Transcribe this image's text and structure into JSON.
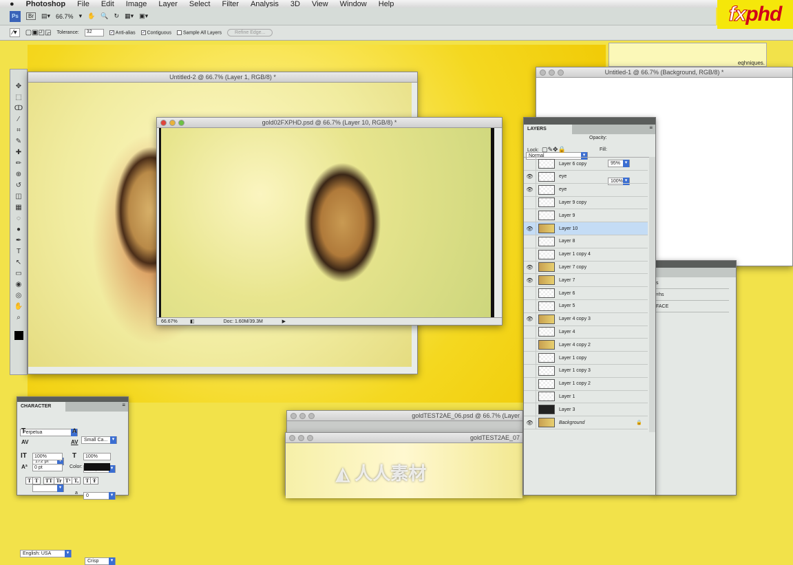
{
  "menubar": {
    "app": "Photoshop",
    "items": [
      "File",
      "Edit",
      "Image",
      "Layer",
      "Select",
      "Filter",
      "Analysis",
      "3D",
      "View",
      "Window",
      "Help"
    ]
  },
  "appbar": {
    "ps": "Ps",
    "br": "Br",
    "zoom": "66.7%"
  },
  "options": {
    "tolerance_label": "Tolerance:",
    "tolerance": "32",
    "anti_alias": "Anti-alias",
    "contiguous": "Contiguous",
    "sample_all": "Sample All Layers",
    "refine": "Refine Edge..."
  },
  "logo": {
    "fx": "fx",
    "phd": "phd"
  },
  "windows": {
    "untitled2": "Untitled-2 @ 66.7% (Layer 1, RGB/8) *",
    "gold02": "gold02FXPHD.psd @ 66.7% (Layer 10, RGB/8) *",
    "gold02_zoom": "66.67%",
    "gold02_doc": "Doc: 1.60M/39.3M",
    "untitled1": "Untitled-1 @ 66.7% (Background, RGB/8) *",
    "techniques": "eqhniques.",
    "gold06": "goldTEST2AE_06.psd @ 66.7% (Layer",
    "gold07": "goldTEST2AE_07"
  },
  "side_panel": {
    "rows": [
      "s",
      "=hs",
      "FACE"
    ]
  },
  "layers": {
    "tab": "LAYERS",
    "blend": "Normal",
    "opacity_label": "Opacity:",
    "opacity": "95%",
    "lock_label": "Lock:",
    "fill_label": "Fill:",
    "fill": "100%",
    "items": [
      {
        "name": "Layer 6 copy",
        "visible": false
      },
      {
        "name": "eye",
        "visible": true
      },
      {
        "name": "eye",
        "visible": true
      },
      {
        "name": "Layer 9 copy",
        "visible": false
      },
      {
        "name": "Layer 9",
        "visible": false
      },
      {
        "name": "Layer 10",
        "visible": true,
        "selected": true
      },
      {
        "name": "Layer 8",
        "visible": false
      },
      {
        "name": "Layer 1 copy 4",
        "visible": false
      },
      {
        "name": "Layer 7 copy",
        "visible": true
      },
      {
        "name": "Layer 7",
        "visible": true
      },
      {
        "name": "Layer 6",
        "visible": false
      },
      {
        "name": "Layer 5",
        "visible": false
      },
      {
        "name": "Layer 4 copy 3",
        "visible": true
      },
      {
        "name": "Layer 4",
        "visible": false
      },
      {
        "name": "Layer 4 copy 2",
        "visible": false
      },
      {
        "name": "Layer 1 copy",
        "visible": false
      },
      {
        "name": "Layer 1 copy 3",
        "visible": false
      },
      {
        "name": "Layer 1 copy 2",
        "visible": false
      },
      {
        "name": "Layer 1",
        "visible": false
      },
      {
        "name": "Layer 3",
        "visible": false
      },
      {
        "name": "Background",
        "visible": true,
        "locked": true
      }
    ]
  },
  "character": {
    "tab": "CHARACTER",
    "font": "Perpetua",
    "style": "Small Ca...",
    "size": "172 pt",
    "leading": "172 pt",
    "kerning": "",
    "tracking": "0",
    "vscale": "100%",
    "hscale": "100%",
    "baseline": "0 pt",
    "color_label": "Color:",
    "color": "#111111",
    "language": "English: USA",
    "aa_label": "a",
    "aa": "Crisp",
    "style_buttons": [
      "T",
      "T",
      "TT",
      "Tr",
      "T¹",
      "T,",
      "T",
      "Ŧ"
    ]
  },
  "watermark": "人人素材"
}
